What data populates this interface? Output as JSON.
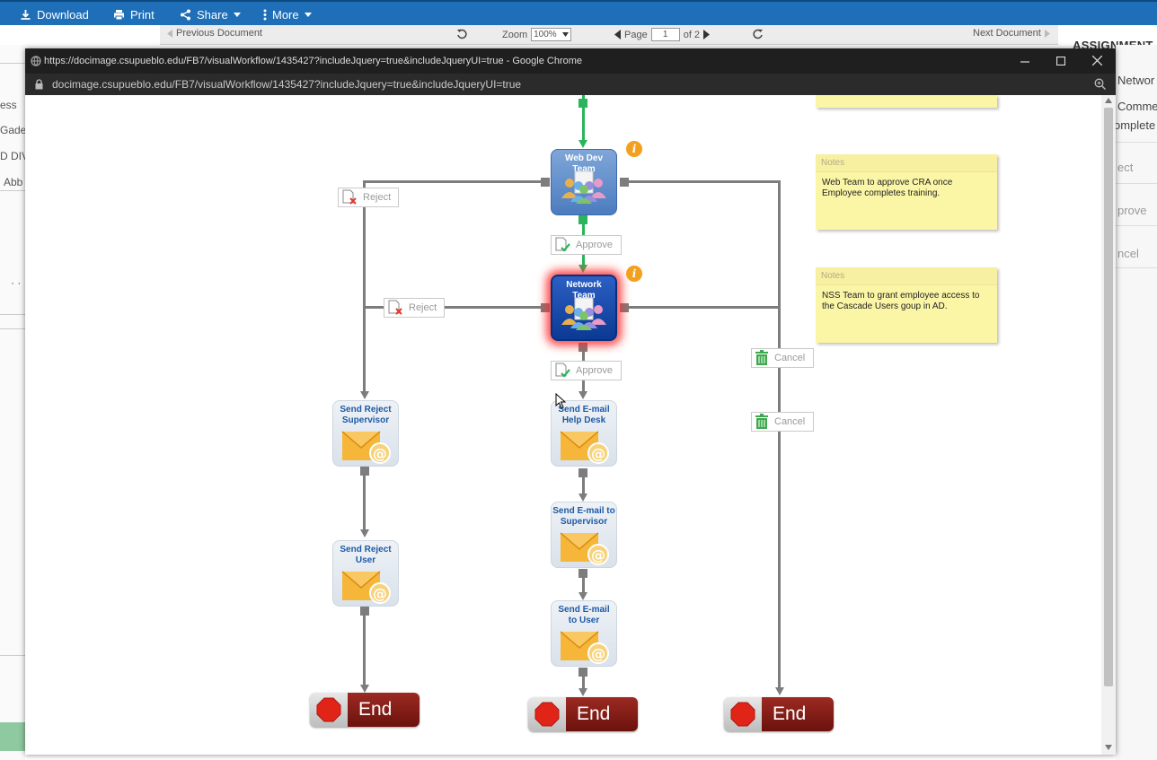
{
  "toolbar": {
    "download": "Download",
    "print": "Print",
    "share": "Share",
    "more": "More"
  },
  "doc_nav": {
    "previous": "Previous Document",
    "zoom_label": "Zoom",
    "zoom_value": "100%",
    "page_label": "Page",
    "page_value": "1",
    "page_total": "of 2",
    "next": "Next Document"
  },
  "left_panel": {
    "items": [
      "ess",
      "Gade",
      "D DIV",
      "Abb",
      "· ·"
    ]
  },
  "right_panel": {
    "heading": "ASSIGNMENT",
    "items": [
      "Networ",
      "Comme",
      "omplete",
      "ect",
      "prove",
      "ncel"
    ]
  },
  "popup": {
    "title": "https://docimage.csupueblo.edu/FB7/visualWorkflow/1435427?includeJquery=true&includeJqueryUI=true - Google Chrome",
    "url": "docimage.csupueblo.edu/FB7/visualWorkflow/1435427?includeJquery=true&includeJqueryUI=true"
  },
  "workflow": {
    "nodes": {
      "web_dev": "Web Dev Team",
      "network": "Network Team",
      "send_reject_supervisor": "Send Reject Supervisor",
      "send_reject_user": "Send Reject User",
      "send_email_helpdesk": "Send E-mail Help Desk",
      "send_email_supervisor": "Send E-mail to Supervisor",
      "send_email_user": "Send E-mail to User"
    },
    "actions": {
      "reject_1": "Reject",
      "reject_2": "Reject",
      "approve_1": "Approve",
      "approve_2": "Approve",
      "cancel_1": "Cancel",
      "cancel_2": "Cancel"
    },
    "end_label": "End",
    "info_symbol": "i",
    "notes": [
      {
        "header": "",
        "body": ""
      },
      {
        "header": "Notes",
        "body": "Web Team to approve CRA once Employee completes training."
      },
      {
        "header": "Notes",
        "body": "NSS Team to grant employee access to the Cascade Users goup in AD."
      }
    ]
  },
  "colors": {
    "toolbar_blue": "#1e6fb8",
    "approve_path_green": "#2bb45b",
    "active_glow_red": "#ff2828",
    "end_red": "#8a1d16",
    "note_yellow": "#fbf6a6"
  },
  "icons": [
    "download-icon",
    "print-icon",
    "share-icon",
    "more-icon",
    "rotate-icon",
    "refresh-icon",
    "lock-icon",
    "globe-icon",
    "zoom-icon",
    "stop-icon",
    "trash-icon",
    "doc-check-icon",
    "doc-x-icon",
    "envelope-icon",
    "team-icon",
    "info-icon"
  ]
}
